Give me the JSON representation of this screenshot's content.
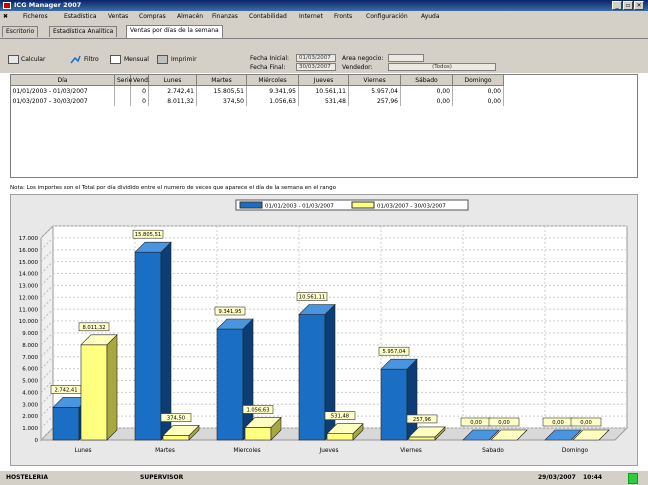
{
  "window": {
    "title": "ICG Manager 2007",
    "minimize": "_",
    "maximize": "▫",
    "close": "✕"
  },
  "menu": [
    "Ficheros",
    "Estadística",
    "Ventas",
    "Compras",
    "Almacén",
    "Finanzas",
    "Contabilidad",
    "Internet",
    "Fronts",
    "Configuración",
    "Ayuda"
  ],
  "tabs": [
    "Escritorio",
    "Estadística Analítica",
    "Ventas por días de la semana"
  ],
  "toolbar": {
    "calcular": "Calcular",
    "filtro": "Filtro",
    "mensual": "Mensual",
    "imprimir": "Imprimir"
  },
  "filters": {
    "fecha_inicial_label": "Fecha Inicial:",
    "fecha_inicial": "01/03/2007",
    "fecha_final_label": "Fecha Final:",
    "fecha_final": "30/03/2007",
    "area_label": "Area negocio:",
    "area": "",
    "vendedor_label": "Vendedor:",
    "vendedor": "(Todos)"
  },
  "table": {
    "headers": [
      "Día",
      "Serie",
      "Vend.",
      "Lunes",
      "Martes",
      "Miércoles",
      "Jueves",
      "Viernes",
      "Sábado",
      "Domingo"
    ],
    "rows": [
      [
        "01/01/2003 - 01/03/2007",
        "",
        "0",
        "2.742,41",
        "15.805,51",
        "9.341,95",
        "10.561,11",
        "5.957,04",
        "0,00",
        "0,00"
      ],
      [
        "01/03/2007 - 30/03/2007",
        "",
        "0",
        "8.011,32",
        "374,50",
        "1.056,63",
        "531,48",
        "257,96",
        "0,00",
        "0,00"
      ]
    ]
  },
  "note": "Nota: Los importes son el Total por día dividido entre el numero de veces que aparece el día de la semana en el rango",
  "chart_data": {
    "type": "bar",
    "categories": [
      "Lunes",
      "Martes",
      "Miercoles",
      "Jueves",
      "Viernes",
      "Sabado",
      "Domingo"
    ],
    "series": [
      {
        "name": "01/01/2003 - 01/03/2007",
        "color": "#1a6fc4",
        "values": [
          2742.41,
          15805.51,
          9341.95,
          10561.11,
          5957.04,
          0,
          0
        ],
        "labels": [
          "2.742,41",
          "15.805,51",
          "9.341,95",
          "10.561,11",
          "5.957,04",
          "0,00",
          "0,00"
        ]
      },
      {
        "name": "01/03/2007 - 30/03/2007",
        "color": "#ffff80",
        "values": [
          8011.32,
          374.5,
          1056.63,
          531.48,
          257.96,
          0,
          0
        ],
        "labels": [
          "8.011,32",
          "374,50",
          "1.056,63",
          "531,48",
          "257,96",
          "0,00",
          "0,00"
        ]
      }
    ],
    "yticks": [
      "0",
      "1.000",
      "2.000",
      "3.000",
      "4.000",
      "5.000",
      "6.000",
      "7.000",
      "8.000",
      "9.000",
      "10.000",
      "11.000",
      "12.000",
      "13.000",
      "14.000",
      "15.000",
      "16.000",
      "17.000"
    ],
    "ylim": [
      0,
      17000
    ],
    "legend": "top-center",
    "grid": true
  },
  "status": {
    "empresa": "HOSTELERIA",
    "usuario": "SUPERVISOR",
    "fecha": "29/03/2007",
    "hora": "10:44"
  }
}
